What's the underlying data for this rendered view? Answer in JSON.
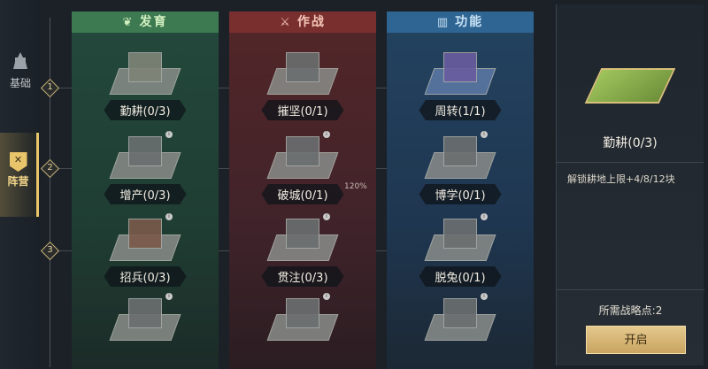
{
  "nav": {
    "basic_label": "基础",
    "camp_label": "阵营"
  },
  "tiers": [
    "1",
    "2",
    "3"
  ],
  "columns": {
    "dev": {
      "header": "发育",
      "nodes": [
        {
          "label": "勤耕(0/3)"
        },
        {
          "label": "增产(0/3)"
        },
        {
          "label": "招兵(0/3)"
        }
      ]
    },
    "war": {
      "header": "作战",
      "nodes": [
        {
          "label": "摧坚(0/1)"
        },
        {
          "label": "破城(0/1)"
        },
        {
          "label": "贯注(0/3)"
        }
      ],
      "percent": "120%"
    },
    "fun": {
      "header": "功能",
      "nodes": [
        {
          "label": "周转(1/1)"
        },
        {
          "label": "博学(0/1)"
        },
        {
          "label": "脱兔(0/1)"
        }
      ]
    }
  },
  "detail": {
    "title": "勤耕(0/3)",
    "description": "解锁耕地上限+4/8/12块",
    "cost": "所需战略点:2",
    "button": "开启"
  },
  "colors": {
    "dev": "#3d7a52",
    "war": "#7a2f2f",
    "fun": "#2f6592",
    "gold": "#e8c46a"
  },
  "icons": {
    "basic": "tower-icon",
    "camp": "shield-icon",
    "dev": "leaf-icon",
    "war": "sword-icon",
    "fun": "book-icon"
  }
}
